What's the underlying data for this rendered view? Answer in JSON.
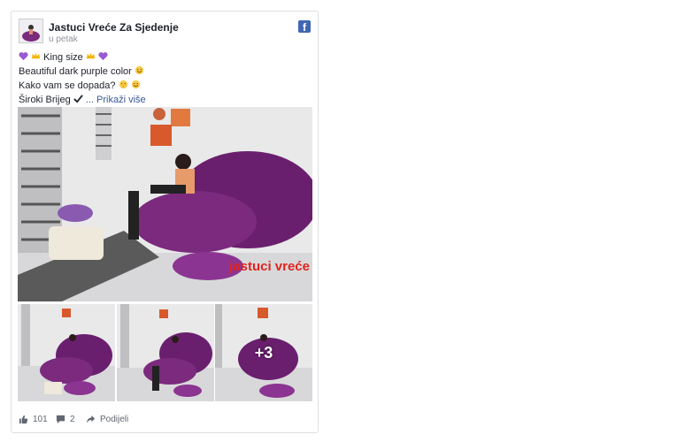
{
  "post": {
    "page_name": "Jastuci Vreće Za Sjedenje",
    "timestamp": "u petak",
    "brand_icon": "facebook-icon",
    "lines": {
      "l1_text": "King size",
      "l2_text": "Beautiful dark purple color",
      "l3_text": "Kako vam se dopada?",
      "l4_text": "Široki Brijeg",
      "see_more": "... Prikaži više"
    },
    "more_photos_label": "+3",
    "watermark": "jastuci vreće",
    "accent_color": "#7b2a7e",
    "link_color": "#385898"
  },
  "footer": {
    "likes": "101",
    "comments": "2",
    "share_label": "Podijeli"
  }
}
